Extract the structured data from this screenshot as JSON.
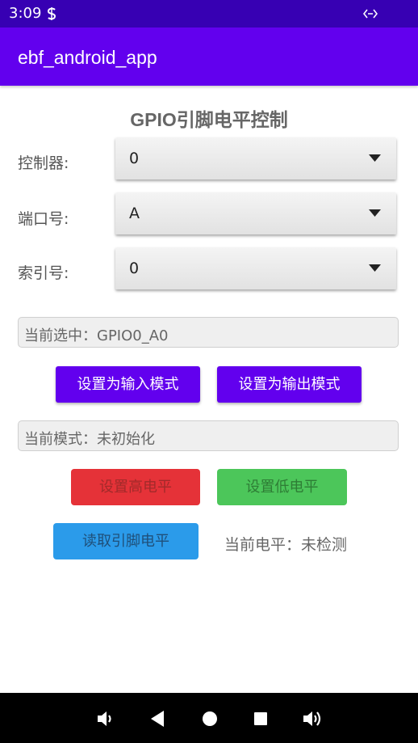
{
  "status_bar": {
    "time": "3:09"
  },
  "app_bar": {
    "title": "ebf_android_app"
  },
  "heading": "GPIO引脚电平控制",
  "controller": {
    "label": "控制器:",
    "value": "0"
  },
  "port": {
    "label": "端口号:",
    "value": "A"
  },
  "index": {
    "label": "索引号:",
    "value": "0"
  },
  "current_selection": "当前选中：GPIO0_A0",
  "buttons": {
    "set_input": "设置为输入模式",
    "set_output": "设置为输出模式",
    "set_high": "设置高电平",
    "set_low": "设置低电平",
    "read_level": "读取引脚电平"
  },
  "current_mode": "当前模式：未初始化",
  "current_level": "当前电平：未检测",
  "colors": {
    "status_bar": "#3700b3",
    "app_bar": "#6200ee",
    "button_purple": "#6200ee",
    "button_red": "#e53238",
    "button_green": "#4cc65a",
    "button_blue": "#2b9bea"
  },
  "nav_icons": [
    "volume-down-icon",
    "back-icon",
    "home-icon",
    "recents-icon",
    "volume-up-icon"
  ]
}
